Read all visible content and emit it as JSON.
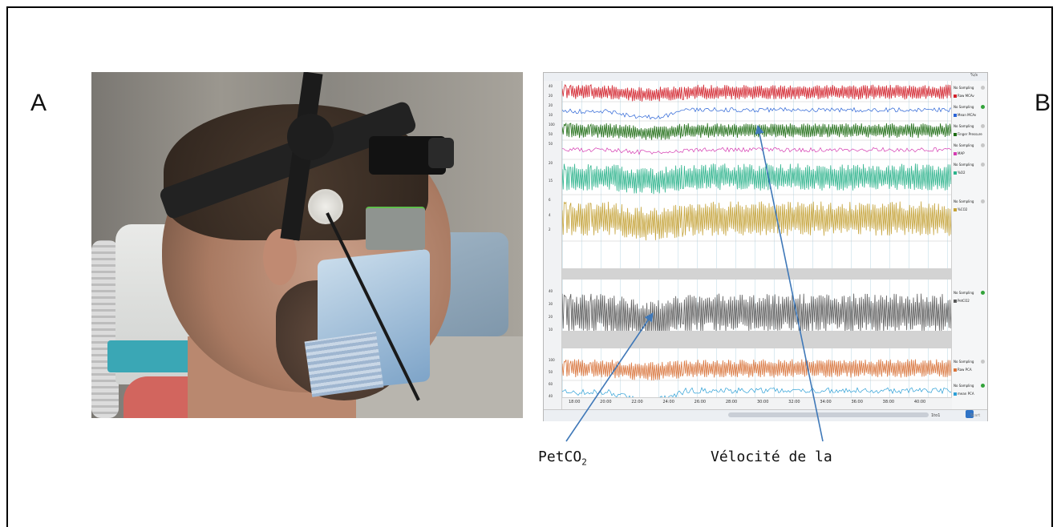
{
  "panels": {
    "a_label": "A",
    "b_label": "B"
  },
  "photo": {
    "subject": "participant-with-transcranial-doppler-headset",
    "redaction_color": "#8f9490"
  },
  "monitor": {
    "top_label": "%/s",
    "channels": [
      {
        "status": "No Sampling",
        "name": "Raw MCAv",
        "color": "#d2202a",
        "active": false,
        "ticks": [
          "40",
          "20"
        ]
      },
      {
        "status": "No Sampling",
        "name": "Mean MCAv",
        "color": "#2a63d6",
        "active": true,
        "ticks": [
          "20",
          "10"
        ]
      },
      {
        "status": "No Sampling",
        "name": "Finger Pressure",
        "color": "#1d6b12",
        "active": false,
        "ticks": [
          "100",
          "50"
        ]
      },
      {
        "status": "No Sampling",
        "name": "MAP",
        "color": "#d53bb1",
        "active": false,
        "ticks": [
          "50"
        ]
      },
      {
        "status": "No Sampling",
        "name": "%O2",
        "color": "#2db38c",
        "active": false,
        "ticks": [
          "20",
          "15"
        ]
      },
      {
        "status": "No Sampling",
        "name": "%CO2",
        "color": "#c5a33a",
        "active": false,
        "ticks": [
          "6",
          "4",
          "2"
        ]
      },
      {
        "status": "No Sampling",
        "name": "PetCO2",
        "color": "#5a5a5a",
        "active": true,
        "ticks": [
          "40",
          "30",
          "20",
          "10"
        ]
      },
      {
        "status": "No Sampling",
        "name": "Raw PCA",
        "color": "#d9743b",
        "active": false,
        "ticks": [
          "100",
          "50"
        ]
      },
      {
        "status": "No Sampling",
        "name": "mean PCA",
        "color": "#2c9fd6",
        "active": true,
        "ticks": [
          "60",
          "40"
        ]
      }
    ],
    "time_ticks": [
      "18:00",
      "20:00",
      "22:00",
      "24:00",
      "26:00",
      "28:00",
      "30:00",
      "32:00",
      "34:00",
      "36:00",
      "38:00",
      "40:00"
    ],
    "status_bar": "1to1",
    "start_label": "Start"
  },
  "annotations": {
    "petco2": "PetCO",
    "petco2_sub": "2",
    "velocity": "Vélocité de la"
  },
  "colors": {
    "arrow": "#3f78b8",
    "frame": "#000000"
  }
}
